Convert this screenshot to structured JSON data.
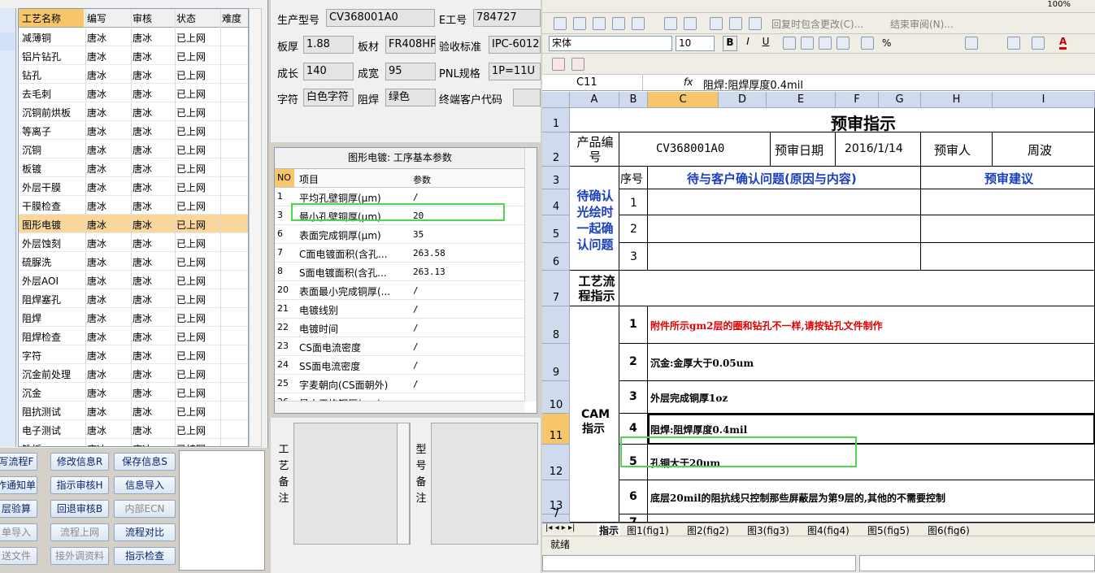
{
  "process_list": {
    "headers": [
      "工艺名称",
      "编写",
      "审核",
      "状态",
      "难度"
    ],
    "rows": [
      [
        "减薄铜",
        "唐冰",
        "唐冰",
        "已上网",
        ""
      ],
      [
        "铝片钻孔",
        "唐冰",
        "唐冰",
        "已上网",
        ""
      ],
      [
        "钻孔",
        "唐冰",
        "唐冰",
        "已上网",
        ""
      ],
      [
        "去毛刺",
        "唐冰",
        "唐冰",
        "已上网",
        ""
      ],
      [
        "沉铜前烘板",
        "唐冰",
        "唐冰",
        "已上网",
        ""
      ],
      [
        "等离子",
        "唐冰",
        "唐冰",
        "已上网",
        ""
      ],
      [
        "沉铜",
        "唐冰",
        "唐冰",
        "已上网",
        ""
      ],
      [
        "板镀",
        "唐冰",
        "唐冰",
        "已上网",
        ""
      ],
      [
        "外层干膜",
        "唐冰",
        "唐冰",
        "已上网",
        ""
      ],
      [
        "干膜检查",
        "唐冰",
        "唐冰",
        "已上网",
        ""
      ],
      [
        "图形电镀",
        "唐冰",
        "唐冰",
        "已上网",
        ""
      ],
      [
        "外层蚀刻",
        "唐冰",
        "唐冰",
        "已上网",
        ""
      ],
      [
        "硫脲洗",
        "唐冰",
        "唐冰",
        "已上网",
        ""
      ],
      [
        "外层AOI",
        "唐冰",
        "唐冰",
        "已上网",
        ""
      ],
      [
        "阻焊塞孔",
        "唐冰",
        "唐冰",
        "已上网",
        ""
      ],
      [
        "阻焊",
        "唐冰",
        "唐冰",
        "已上网",
        ""
      ],
      [
        "阻焊检查",
        "唐冰",
        "唐冰",
        "已上网",
        ""
      ],
      [
        "字符",
        "唐冰",
        "唐冰",
        "已上网",
        ""
      ],
      [
        "沉金前处理",
        "唐冰",
        "唐冰",
        "已上网",
        ""
      ],
      [
        "沉金",
        "唐冰",
        "唐冰",
        "已上网",
        ""
      ],
      [
        "阻抗测试",
        "唐冰",
        "唐冰",
        "已上网",
        ""
      ],
      [
        "电子测试",
        "唐冰",
        "唐冰",
        "已上网",
        ""
      ],
      [
        "铣板",
        "唐冰",
        "唐冰",
        "已编写",
        ""
      ]
    ],
    "selected_index": 10
  },
  "buttons": [
    {
      "label": "写流程F",
      "enabled": true
    },
    {
      "label": "修改信息R",
      "enabled": true
    },
    {
      "label": "保存信息S",
      "enabled": true
    },
    {
      "label": "作通知单",
      "enabled": true
    },
    {
      "label": "指示审核H",
      "enabled": true
    },
    {
      "label": "信息导入",
      "enabled": true
    },
    {
      "label": "层验算",
      "enabled": true
    },
    {
      "label": "回退审核B",
      "enabled": true
    },
    {
      "label": "内部ECN",
      "enabled": false
    },
    {
      "label": "单导入",
      "enabled": false
    },
    {
      "label": "流程上网",
      "enabled": false
    },
    {
      "label": "流程对比",
      "enabled": true
    },
    {
      "label": "送文件",
      "enabled": false
    },
    {
      "label": "接外调资料",
      "enabled": false
    },
    {
      "label": "指示检查",
      "enabled": true
    }
  ],
  "info": {
    "model_label": "生产型号",
    "model": "CV368001A0",
    "eno_label": "E工号",
    "eno": "784727",
    "thickness_label": "板厚",
    "thickness": "1.88",
    "material_label": "板材",
    "material": "FR408HR",
    "accept_label": "验收标准",
    "accept": "IPC-6012",
    "length_label": "成长",
    "length": "140",
    "width_label": "成宽",
    "width": "95",
    "pnl_label": "PNL规格",
    "pnl": "1P=11U",
    "char_label": "字符",
    "char": "白色字符",
    "mask_label": "阻焊",
    "mask": "绿色",
    "endcust_label": "终端客户代码",
    "endcust": ""
  },
  "params": {
    "title": "图形电镀: 工序基本参数",
    "headers": [
      "NO",
      "项目",
      "参数"
    ],
    "rows": [
      [
        "1",
        "平均孔壁铜厚(μm)",
        "/"
      ],
      [
        "3",
        "最小孔壁铜厚(μm)",
        "20"
      ],
      [
        "6",
        "表面完成铜厚(μm)",
        "35"
      ],
      [
        "7",
        "C面电镀面积(含孔...",
        "263.58"
      ],
      [
        "8",
        "S面电镀面积(含孔...",
        "263.13"
      ],
      [
        "20",
        "表面最小完成铜厚(...",
        "/"
      ],
      [
        "21",
        "电镀线别",
        "/"
      ],
      [
        "22",
        "电镀时间",
        "/"
      ],
      [
        "23",
        "CS面电流密度",
        "/"
      ],
      [
        "24",
        "SS面电流密度",
        "/"
      ],
      [
        "25",
        "字麦朝向(CS面朝外)",
        "/"
      ],
      [
        "26",
        "最小平均铜厚(μm)",
        ""
      ]
    ]
  },
  "notes": {
    "process_label": "工艺备注",
    "model_label": "型号备注"
  },
  "excel": {
    "font_name": "宋体",
    "font_size": "10",
    "toolbar_text1": "回复时包含更改(C)...",
    "toolbar_text2": "结束审阅(N)...",
    "zoom": "100%",
    "cell_ref": "C11",
    "fx": "fx",
    "formula": "阻焊:阻焊厚度0.4mil",
    "columns": [
      "A",
      "B",
      "C",
      "D",
      "E",
      "F",
      "G",
      "H",
      "I"
    ],
    "rows": [
      "1",
      "2",
      "3",
      "4",
      "5",
      "6",
      "7",
      "8",
      "9",
      "10",
      "11",
      "12",
      "13",
      "7"
    ],
    "title": "预审指示",
    "product_no_label": "产品编号",
    "product_no": "CV368001A0",
    "review_date_label": "预审日期",
    "review_date": "2016/1/14",
    "reviewer_label": "预审人",
    "reviewer": "周波",
    "seq_label": "序号",
    "confirm_header": "待与客户确认问题(原因与内容)",
    "advice_header": "预审建议",
    "pending_label": "待确认光绘时一起确认问题",
    "pending_nums": [
      "1",
      "2",
      "3"
    ],
    "flow_label": "工艺流程指示",
    "cam_label": "CAM指示",
    "cam_items": [
      {
        "no": "1",
        "text": "附件所示gm2层的圈和钻孔不一样,请按钻孔文件制作",
        "red": true
      },
      {
        "no": "2",
        "text": "沉金:金厚大于0.05um",
        "red": false
      },
      {
        "no": "3",
        "text": "外层完成铜厚1oz",
        "red": false
      },
      {
        "no": "4",
        "text": "阻焊:阻焊厚度0.4mil",
        "red": false
      },
      {
        "no": "5",
        "text": "孔铜大于20um",
        "red": false
      },
      {
        "no": "6",
        "text": "底层20mil的阻抗线只控制那些屏蔽层为第9层的,其他的不需要控制",
        "red": false
      },
      {
        "no": "7",
        "text": "",
        "red": false
      }
    ],
    "sheet_tabs": [
      "指示",
      "图1(fig1)",
      "图2(fig2)",
      "图3(fig3)",
      "图4(fig4)",
      "图5(fig5)",
      "图6(fig6)"
    ],
    "status": "就绪"
  },
  "colors": {
    "selected_row": "#f9d79a",
    "header_hl": "#f7c66b",
    "green_box": "#4cd64c",
    "red_text": "#e00000",
    "blue_text": "#1a3fc0"
  }
}
